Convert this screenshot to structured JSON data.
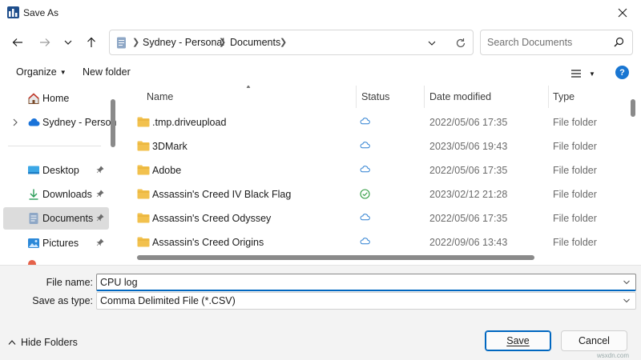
{
  "window": {
    "title": "Save As"
  },
  "address": {
    "crumbs": [
      "Sydney - Personal",
      "Documents"
    ]
  },
  "search": {
    "placeholder": "Search Documents"
  },
  "toolbar": {
    "organize_label": "Organize",
    "new_folder_label": "New folder",
    "help_label": "?"
  },
  "nav": {
    "items": [
      {
        "label": "Home",
        "icon": "home-icon"
      },
      {
        "label": "Sydney - Person",
        "icon": "cloud-icon"
      },
      {
        "label": "Desktop",
        "icon": "desktop-icon"
      },
      {
        "label": "Downloads",
        "icon": "download-icon"
      },
      {
        "label": "Documents",
        "icon": "documents-icon"
      },
      {
        "label": "Pictures",
        "icon": "pictures-icon"
      }
    ]
  },
  "columns": {
    "name": "Name",
    "status": "Status",
    "date": "Date modified",
    "type": "Type"
  },
  "rows": [
    {
      "name": ".tmp.driveupload",
      "status": "cloud",
      "date": "2022/05/06 17:35",
      "type": "File folder"
    },
    {
      "name": "3DMark",
      "status": "cloud",
      "date": "2023/05/06 19:43",
      "type": "File folder"
    },
    {
      "name": "Adobe",
      "status": "cloud",
      "date": "2022/05/06 17:35",
      "type": "File folder"
    },
    {
      "name": "Assassin's Creed IV Black Flag",
      "status": "synced",
      "date": "2023/02/12 21:28",
      "type": "File folder"
    },
    {
      "name": "Assassin's Creed Odyssey",
      "status": "cloud",
      "date": "2022/05/06 17:35",
      "type": "File folder"
    },
    {
      "name": "Assassin's Creed Origins",
      "status": "cloud",
      "date": "2022/09/06 13:43",
      "type": "File folder"
    }
  ],
  "fields": {
    "file_name_label": "File name:",
    "file_name_value": "CPU log",
    "save_type_label": "Save as type:",
    "save_type_value": "Comma Delimited File (*.CSV)"
  },
  "footer": {
    "hide_folders_label": "Hide Folders",
    "save_label": "Save",
    "cancel_label": "Cancel",
    "watermark": "wsxdn.com"
  },
  "colors": {
    "accent": "#0067c0",
    "folder": "#f2c14e",
    "cloud_status": "#2b7fd1",
    "synced_status": "#2e9b3f"
  }
}
